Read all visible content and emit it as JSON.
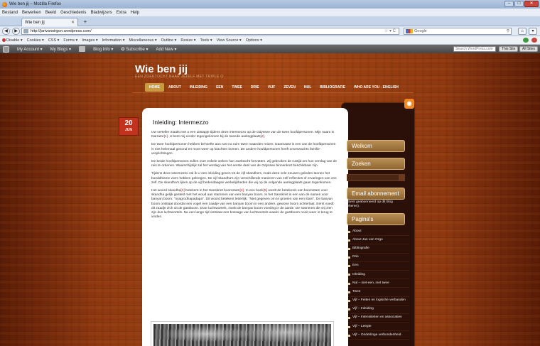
{
  "browser": {
    "window_title": "Wie ben jij – Mozilla Firefox",
    "menu": [
      "Bestand",
      "Bewerken",
      "Beeld",
      "Geschiedenis",
      "Bladwijzers",
      "Extra",
      "Help"
    ],
    "tab_label": "Wie ben jij",
    "url": "http://jarivanoirgon.wordpress.com/",
    "search_placeholder": "Google",
    "webdev_toolbar": [
      "Disable",
      "Cookies",
      "CSS",
      "Forms",
      "Images",
      "Information",
      "Miscellaneous",
      "Outline",
      "Resize",
      "Tools",
      "View Source",
      "Options"
    ]
  },
  "adminbar": {
    "items": [
      "My Account",
      "My Blogs",
      "Blog Info",
      "Subscribe",
      "Add New"
    ],
    "search_placeholder": "Search WordPress.com",
    "this_site": "This Site",
    "all_sites": "All Sites"
  },
  "site": {
    "title": "Wie ben jij",
    "tagline": "EEN ZOEKTOCHT NAAR JEZELF MET TRIPLE O",
    "nav": [
      "HOME",
      "ABOUT",
      "INLEIDING",
      "EEN",
      "TWEE",
      "DRIE",
      "VIJF",
      "ZEVEN",
      "NUL",
      "BIBLIOGRAFIE",
      "WHO ARE YOU - ENGLISH"
    ]
  },
  "post": {
    "date_day": "20",
    "date_month": "JUN",
    "title": "Inleiding: Intermezzo",
    "p1": "Uw verteller maakt met u een uitstapje tijdens deze intermezzo op de Odyssee van de twee hoofdpersonen. Mijn naam is Narrator[1]. U bent mij eerder tegengekomen bij de tweede aanlegplaats[2].",
    "p2": "De twee hoofdpersonen hebben behoefte aan rust na ruim twee maanden reizen. Daarnaast is een van de hoofdpersonen is niet helemaal gezond en moet weer op krachten komen. De andere hoofdpersonen heeft onverwachts familie-verplichtingen.",
    "p3": "De beide hoofdpersonen zullen over enkele weken hun zoektocht hervatten. Zij gebruiken de rustijd om hun verslag van de reis te ordenen. Waarschijnlijk zal het verslag van het eerste deel van de Odyssee binnenkort beschikbaar zijn.",
    "p4": "Tijdens deze intermezzo zal ik U een inleiding geven tot de vijf skandha's, zoals deze vele eeuwen geleden tannen het boeddhisme vorm hebben gekregen. De vijf skandha's zijn verschillende manieren van zelf reflecties of ervaringen van ons zelf. De skandha's lijken op de vijf hedendaagse werkelijkheden die wij op de volgende aanlegplaats gaan tegenkomen.",
    "p5": "Het woord skandha[3] betekent in het Sanskriet boomstam[4]. In een boek[5] wordt de betekenis van boomstam voor skandha gelijk gesteld met het woud aan stammen van een banyan boom. In het Sanskriet is een van de namen voor banyan boom: \"nyagrodhapadapa\". Dit woord betekent letterlijk, \"Niet gegeven om te groeien van een stam\". De banyan boom ontstaat doordat een vogel een zaadje van een banyan boom in een andere, gewone boom achterlaat. Eerst voedt dit zaadje zich uit de gastboom. Door luchtwortels, zoekt de banyan boom voeding in de aarde. De stammen die wij zien zijn dus luchtwortels. Na een lange tijd ontstaat een bossage van luchtwortels waarin de gastboom nooit weer is terug te vinden."
  },
  "sidebar": {
    "welkom": "Welkom",
    "zoeken": "Zoeken",
    "email_title": "Email abonnement",
    "email_text": "Je bent geabonneerd op dit blog (beheren).",
    "pages_title": "Pagina's",
    "pages": [
      "About",
      "About Jan van Orgo",
      "Bibliografie",
      "Drie",
      "Een",
      "Inleiding",
      "Nul – niet-een, niet twee",
      "Twee",
      "Vijf – Feiten en logische verbanden",
      "Vijf – Inleiding",
      "Vijf – Intensiteiten en associaties",
      "Vijf – Leegte",
      "Vijf – Onderlinge verbondenheid"
    ]
  }
}
